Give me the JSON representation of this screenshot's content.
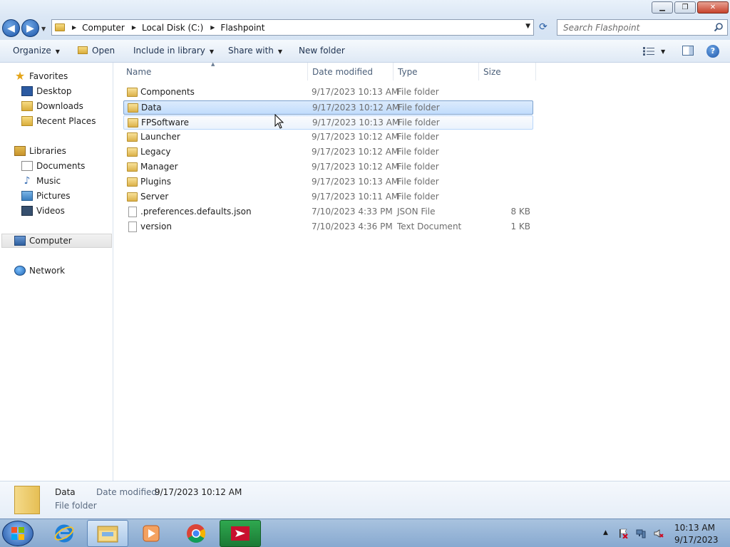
{
  "window": {
    "minimize": "▁",
    "maximize": "❐",
    "close": "✕"
  },
  "address": {
    "crumbs": [
      "Computer",
      "Local Disk (C:)",
      "Flashpoint"
    ],
    "search_placeholder": "Search Flashpoint"
  },
  "toolbar": {
    "organize": "Organize",
    "open": "Open",
    "include_in_library": "Include in library",
    "share_with": "Share with",
    "new_folder": "New folder"
  },
  "nav": {
    "favorites": "Favorites",
    "desktop": "Desktop",
    "downloads": "Downloads",
    "recent_places": "Recent Places",
    "libraries": "Libraries",
    "documents": "Documents",
    "music": "Music",
    "pictures": "Pictures",
    "videos": "Videos",
    "computer": "Computer",
    "network": "Network"
  },
  "columns": {
    "name": "Name",
    "date_modified": "Date modified",
    "type": "Type",
    "size": "Size"
  },
  "files": [
    {
      "name": "Components",
      "date": "9/17/2023 10:13 AM",
      "type": "File folder",
      "size": ""
    },
    {
      "name": "Data",
      "date": "9/17/2023 10:12 AM",
      "type": "File folder",
      "size": ""
    },
    {
      "name": "FPSoftware",
      "date": "9/17/2023 10:13 AM",
      "type": "File folder",
      "size": ""
    },
    {
      "name": "Launcher",
      "date": "9/17/2023 10:12 AM",
      "type": "File folder",
      "size": ""
    },
    {
      "name": "Legacy",
      "date": "9/17/2023 10:12 AM",
      "type": "File folder",
      "size": ""
    },
    {
      "name": "Manager",
      "date": "9/17/2023 10:12 AM",
      "type": "File folder",
      "size": ""
    },
    {
      "name": "Plugins",
      "date": "9/17/2023 10:13 AM",
      "type": "File folder",
      "size": ""
    },
    {
      "name": "Server",
      "date": "9/17/2023 10:11 AM",
      "type": "File folder",
      "size": ""
    },
    {
      "name": ".preferences.defaults.json",
      "date": "7/10/2023 4:33 PM",
      "type": "JSON File",
      "size": "8 KB"
    },
    {
      "name": "version",
      "date": "7/10/2023 4:36 PM",
      "type": "Text Document",
      "size": "1 KB"
    }
  ],
  "details": {
    "name": "Data",
    "type": "File folder",
    "modified_label": "Date modified:",
    "modified_value": "9/17/2023 10:12 AM"
  },
  "taskbar": {
    "time": "10:13 AM",
    "date": "9/17/2023"
  }
}
